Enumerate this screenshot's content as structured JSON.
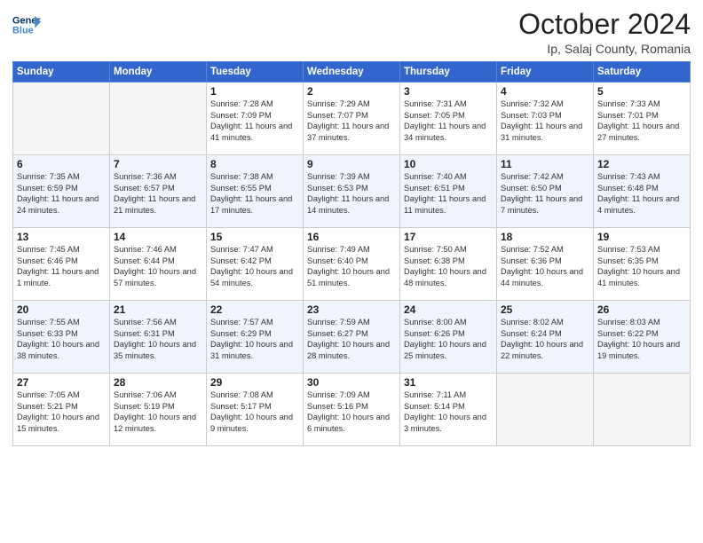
{
  "header": {
    "logo_line1": "General",
    "logo_line2": "Blue",
    "month": "October 2024",
    "location": "Ip, Salaj County, Romania"
  },
  "weekdays": [
    "Sunday",
    "Monday",
    "Tuesday",
    "Wednesday",
    "Thursday",
    "Friday",
    "Saturday"
  ],
  "weeks": [
    [
      {
        "day": "",
        "detail": ""
      },
      {
        "day": "",
        "detail": ""
      },
      {
        "day": "1",
        "detail": "Sunrise: 7:28 AM\nSunset: 7:09 PM\nDaylight: 11 hours and 41 minutes."
      },
      {
        "day": "2",
        "detail": "Sunrise: 7:29 AM\nSunset: 7:07 PM\nDaylight: 11 hours and 37 minutes."
      },
      {
        "day": "3",
        "detail": "Sunrise: 7:31 AM\nSunset: 7:05 PM\nDaylight: 11 hours and 34 minutes."
      },
      {
        "day": "4",
        "detail": "Sunrise: 7:32 AM\nSunset: 7:03 PM\nDaylight: 11 hours and 31 minutes."
      },
      {
        "day": "5",
        "detail": "Sunrise: 7:33 AM\nSunset: 7:01 PM\nDaylight: 11 hours and 27 minutes."
      }
    ],
    [
      {
        "day": "6",
        "detail": "Sunrise: 7:35 AM\nSunset: 6:59 PM\nDaylight: 11 hours and 24 minutes."
      },
      {
        "day": "7",
        "detail": "Sunrise: 7:36 AM\nSunset: 6:57 PM\nDaylight: 11 hours and 21 minutes."
      },
      {
        "day": "8",
        "detail": "Sunrise: 7:38 AM\nSunset: 6:55 PM\nDaylight: 11 hours and 17 minutes."
      },
      {
        "day": "9",
        "detail": "Sunrise: 7:39 AM\nSunset: 6:53 PM\nDaylight: 11 hours and 14 minutes."
      },
      {
        "day": "10",
        "detail": "Sunrise: 7:40 AM\nSunset: 6:51 PM\nDaylight: 11 hours and 11 minutes."
      },
      {
        "day": "11",
        "detail": "Sunrise: 7:42 AM\nSunset: 6:50 PM\nDaylight: 11 hours and 7 minutes."
      },
      {
        "day": "12",
        "detail": "Sunrise: 7:43 AM\nSunset: 6:48 PM\nDaylight: 11 hours and 4 minutes."
      }
    ],
    [
      {
        "day": "13",
        "detail": "Sunrise: 7:45 AM\nSunset: 6:46 PM\nDaylight: 11 hours and 1 minute."
      },
      {
        "day": "14",
        "detail": "Sunrise: 7:46 AM\nSunset: 6:44 PM\nDaylight: 10 hours and 57 minutes."
      },
      {
        "day": "15",
        "detail": "Sunrise: 7:47 AM\nSunset: 6:42 PM\nDaylight: 10 hours and 54 minutes."
      },
      {
        "day": "16",
        "detail": "Sunrise: 7:49 AM\nSunset: 6:40 PM\nDaylight: 10 hours and 51 minutes."
      },
      {
        "day": "17",
        "detail": "Sunrise: 7:50 AM\nSunset: 6:38 PM\nDaylight: 10 hours and 48 minutes."
      },
      {
        "day": "18",
        "detail": "Sunrise: 7:52 AM\nSunset: 6:36 PM\nDaylight: 10 hours and 44 minutes."
      },
      {
        "day": "19",
        "detail": "Sunrise: 7:53 AM\nSunset: 6:35 PM\nDaylight: 10 hours and 41 minutes."
      }
    ],
    [
      {
        "day": "20",
        "detail": "Sunrise: 7:55 AM\nSunset: 6:33 PM\nDaylight: 10 hours and 38 minutes."
      },
      {
        "day": "21",
        "detail": "Sunrise: 7:56 AM\nSunset: 6:31 PM\nDaylight: 10 hours and 35 minutes."
      },
      {
        "day": "22",
        "detail": "Sunrise: 7:57 AM\nSunset: 6:29 PM\nDaylight: 10 hours and 31 minutes."
      },
      {
        "day": "23",
        "detail": "Sunrise: 7:59 AM\nSunset: 6:27 PM\nDaylight: 10 hours and 28 minutes."
      },
      {
        "day": "24",
        "detail": "Sunrise: 8:00 AM\nSunset: 6:26 PM\nDaylight: 10 hours and 25 minutes."
      },
      {
        "day": "25",
        "detail": "Sunrise: 8:02 AM\nSunset: 6:24 PM\nDaylight: 10 hours and 22 minutes."
      },
      {
        "day": "26",
        "detail": "Sunrise: 8:03 AM\nSunset: 6:22 PM\nDaylight: 10 hours and 19 minutes."
      }
    ],
    [
      {
        "day": "27",
        "detail": "Sunrise: 7:05 AM\nSunset: 5:21 PM\nDaylight: 10 hours and 15 minutes."
      },
      {
        "day": "28",
        "detail": "Sunrise: 7:06 AM\nSunset: 5:19 PM\nDaylight: 10 hours and 12 minutes."
      },
      {
        "day": "29",
        "detail": "Sunrise: 7:08 AM\nSunset: 5:17 PM\nDaylight: 10 hours and 9 minutes."
      },
      {
        "day": "30",
        "detail": "Sunrise: 7:09 AM\nSunset: 5:16 PM\nDaylight: 10 hours and 6 minutes."
      },
      {
        "day": "31",
        "detail": "Sunrise: 7:11 AM\nSunset: 5:14 PM\nDaylight: 10 hours and 3 minutes."
      },
      {
        "day": "",
        "detail": ""
      },
      {
        "day": "",
        "detail": ""
      }
    ]
  ]
}
